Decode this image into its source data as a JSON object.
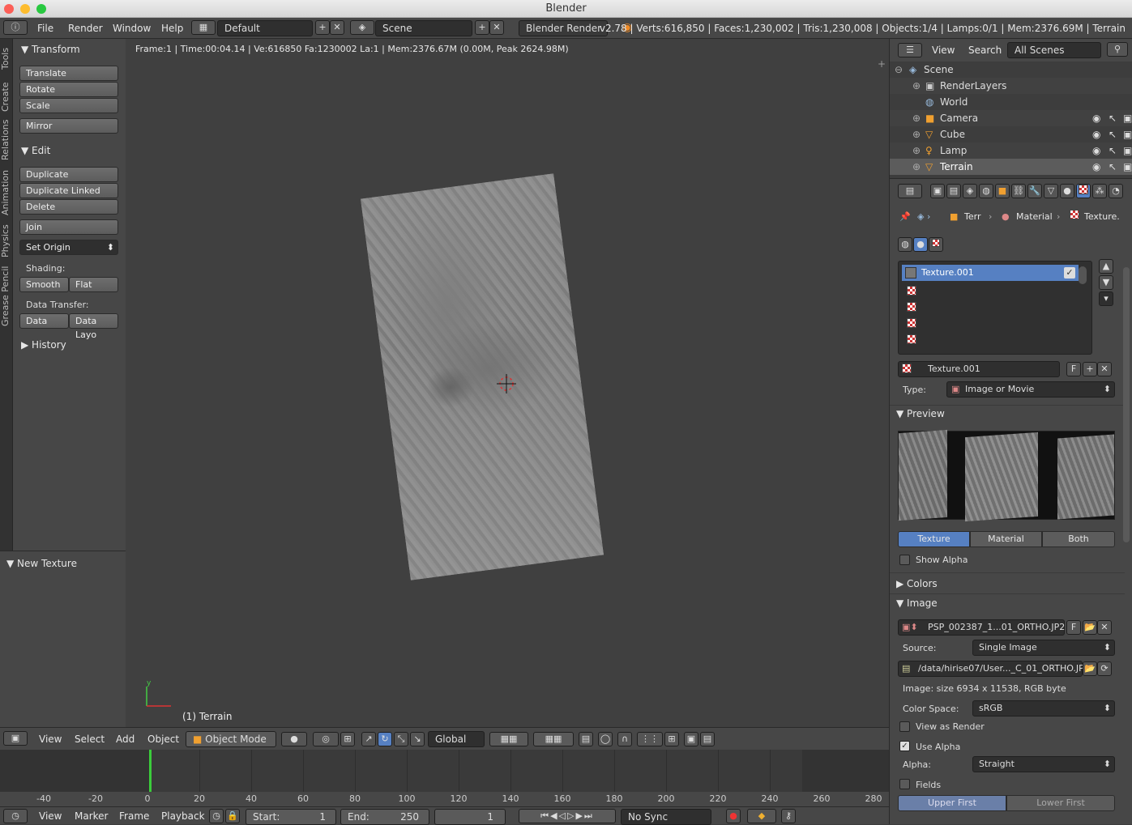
{
  "window": {
    "title": "Blender"
  },
  "infobar": {
    "menus": [
      "File",
      "Render",
      "Window",
      "Help"
    ],
    "layout": "Default",
    "scene": "Scene",
    "engine": "Blender Render",
    "stats": "v2.78 | Verts:616,850 | Faces:1,230,002 | Tris:1,230,008 | Objects:1/4 | Lamps:0/1 | Mem:2376.69M | Terrain"
  },
  "vtabs": [
    "Tools",
    "Create",
    "Relations",
    "Animation",
    "Physics",
    "Grease Pencil"
  ],
  "toolshelf": {
    "transform_title": "Transform",
    "translate": "Translate",
    "rotate": "Rotate",
    "scale": "Scale",
    "mirror": "Mirror",
    "edit_title": "Edit",
    "duplicate": "Duplicate",
    "duplicate_linked": "Duplicate Linked",
    "delete": "Delete",
    "join": "Join",
    "set_origin": "Set Origin",
    "shading_label": "Shading:",
    "smooth": "Smooth",
    "flat": "Flat",
    "data_transfer_label": "Data Transfer:",
    "data": "Data",
    "data_layo": "Data Layo",
    "history": "History",
    "new_texture": "New Texture"
  },
  "viewport": {
    "info": "Frame:1 | Time:00:04.14 | Ve:616850 Fa:1230002 La:1 | Mem:2376.67M (0.00M, Peak 2624.98M)",
    "object_name": "(1) Terrain"
  },
  "vp_header": {
    "view": "View",
    "select": "Select",
    "add": "Add",
    "object": "Object",
    "mode": "Object Mode",
    "orientation": "Global"
  },
  "timeline": {
    "ticks": [
      "-40",
      "-20",
      "0",
      "20",
      "40",
      "60",
      "80",
      "100",
      "120",
      "140",
      "160",
      "180",
      "200",
      "220",
      "240",
      "260",
      "280"
    ]
  },
  "tl_header": {
    "view": "View",
    "marker": "Marker",
    "frame": "Frame",
    "playback": "Playback",
    "start_label": "Start:",
    "start": "1",
    "end_label": "End:",
    "end": "250",
    "current": "1",
    "sync": "No Sync"
  },
  "outliner": {
    "view": "View",
    "search": "Search",
    "filter": "All Scenes",
    "items": [
      "Scene",
      "RenderLayers",
      "World",
      "Camera",
      "Cube",
      "Lamp",
      "Terrain"
    ]
  },
  "props": {
    "breadcrumb_obj": "Terr",
    "breadcrumb_mat": "Material",
    "breadcrumb_tex": "Texture.",
    "slot_selected": "Texture.001",
    "tex_name": "Texture.001",
    "f": "F",
    "type_label": "Type:",
    "type_value": "Image or Movie",
    "preview": "Preview",
    "preview_tabs": [
      "Texture",
      "Material",
      "Both"
    ],
    "show_alpha": "Show Alpha",
    "colors": "Colors",
    "image": "Image",
    "image_name": "PSP_002387_1...01_ORTHO.JP2",
    "source_label": "Source:",
    "source_value": "Single Image",
    "filepath": "/data/hirise07/User..._C_01_ORTHO.JP2",
    "image_info": "Image: size 6934 x 11538, RGB byte",
    "colorspace_label": "Color Space:",
    "colorspace_value": "sRGB",
    "view_as_render": "View as Render",
    "use_alpha": "Use Alpha",
    "alpha_label": "Alpha:",
    "alpha_value": "Straight",
    "fields": "Fields",
    "upper_first": "Upper First",
    "lower_first": "Lower First"
  }
}
